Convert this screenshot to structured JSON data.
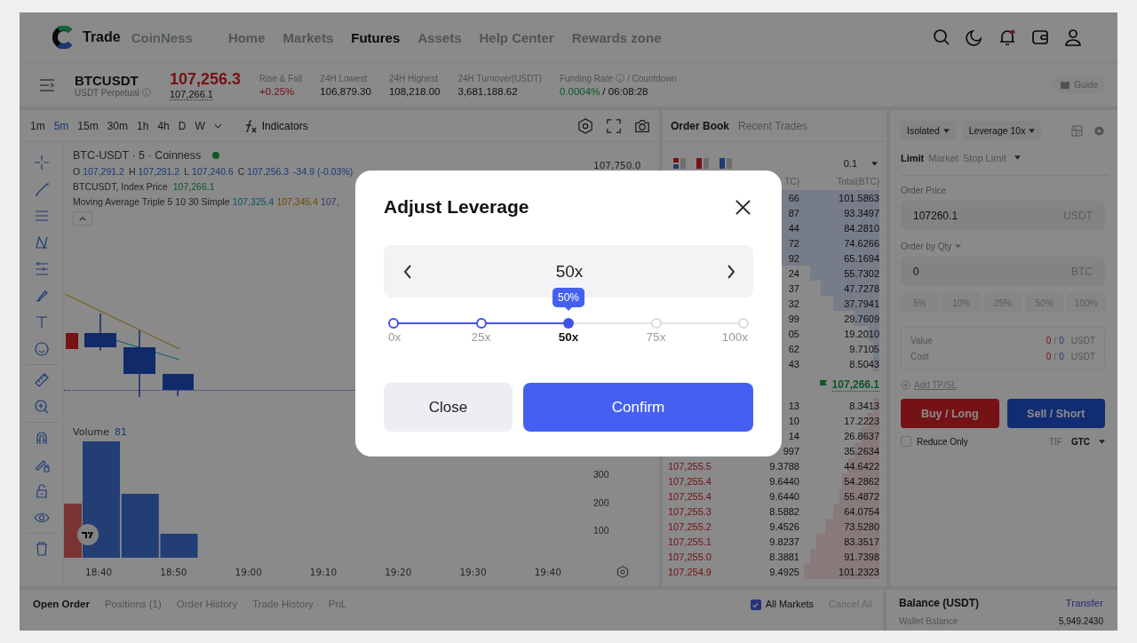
{
  "nav": {
    "logo_text": "Trade",
    "brand": "CoinNess",
    "items": [
      {
        "label": "Home",
        "selected": false
      },
      {
        "label": "Markets",
        "selected": false
      },
      {
        "label": "Futures",
        "selected": true
      },
      {
        "label": "Assets",
        "selected": false
      },
      {
        "label": "Help Center",
        "selected": false
      },
      {
        "label": "Rewards zone",
        "selected": false
      }
    ],
    "has_unread": true
  },
  "ticker": {
    "symbol": "BTCUSDT",
    "contract": "USDT Perpetual",
    "last_price": "107,256.3",
    "mark_price": "107,266.1",
    "stats": [
      {
        "label": "Rise & Fall",
        "value": "+0.25%",
        "highlight": true
      },
      {
        "label": "24H Lowest",
        "value": "106,879.30",
        "highlight": false
      },
      {
        "label": "24H Highest",
        "value": "108,218.00",
        "highlight": false
      },
      {
        "label": "24H Turnover(USDT)",
        "value": "3,681,188.62",
        "highlight": false
      }
    ],
    "funding": {
      "label": "Funding Rate",
      "label_tail": "/ Countdown",
      "rate": "0.0004%",
      "countdown": "/ 06:08:28"
    },
    "guide": "Guide"
  },
  "chart": {
    "intervals": [
      {
        "label": "1m",
        "selected": false
      },
      {
        "label": "5m",
        "selected": true
      },
      {
        "label": "15m",
        "selected": false
      },
      {
        "label": "30m",
        "selected": false
      },
      {
        "label": "1h",
        "selected": false
      },
      {
        "label": "4h",
        "selected": false
      },
      {
        "label": "D",
        "selected": false
      },
      {
        "label": "W",
        "selected": false
      }
    ],
    "indicators": "Indicators",
    "legend": {
      "title": "BTC-USDT · 5 · Coinness",
      "live": true,
      "ohlc": [
        {
          "label": "O",
          "value": "107,291.2"
        },
        {
          "label": "H",
          "value": "107,291.2"
        },
        {
          "label": "L",
          "value": "107,240.6"
        },
        {
          "label": "C",
          "value": "107,256.3"
        }
      ],
      "change": "-34.9 (-0.03%)",
      "index_label": "BTCUSDT, Index Price",
      "index_value": "107,266.1",
      "ma_label": "Moving Average Triple 5 10 30 Simple",
      "ma_values": [
        "107,325.4",
        "107,345.4",
        "107,"
      ]
    },
    "price_tick": "107,750.0",
    "volume": {
      "label": "Volume",
      "value": "81",
      "ticks": [
        "300",
        "200",
        "100"
      ]
    },
    "time_axis": [
      "18:40",
      "18:50",
      "19:00",
      "19:10",
      "19:20",
      "19:30",
      "19:40"
    ]
  },
  "order_book": {
    "tabs": [
      {
        "label": "Order Book",
        "selected": true
      },
      {
        "label": "Recent Trades",
        "selected": false
      }
    ],
    "step": "0.1",
    "columns": [
      "TC)",
      "Total(BTC)"
    ],
    "asks": [
      {
        "quantity": "66",
        "total": "101.5863"
      },
      {
        "quantity": "87",
        "total": "93.3497"
      },
      {
        "quantity": "44",
        "total": "84.2810"
      },
      {
        "quantity": "72",
        "total": "74.6266"
      },
      {
        "quantity": "92",
        "total": "65.1694"
      },
      {
        "quantity": "24",
        "total": "55.7302"
      },
      {
        "quantity": "37",
        "total": "47.7278"
      },
      {
        "quantity": "32",
        "total": "37.7941"
      },
      {
        "quantity": "99",
        "total": "29.7609"
      },
      {
        "quantity": "05",
        "total": "19.2010"
      },
      {
        "quantity": "62",
        "total": "9.7105"
      },
      {
        "quantity": "43",
        "total": "8.5043"
      }
    ],
    "mid_price": "107,266.1",
    "bids": [
      {
        "quantity": "13",
        "total": "8.3413"
      },
      {
        "quantity": "10",
        "total": "17.2223"
      },
      {
        "quantity": "14",
        "total": "26.8637"
      },
      {
        "quantity": "997",
        "total": "35.2634"
      },
      {
        "price": "107,255.5",
        "quantity": "9.3788",
        "total": "44.6422"
      },
      {
        "price": "107,255.4",
        "quantity": "9.6440",
        "total": "54.2862"
      },
      {
        "price": "107,255.4",
        "quantity": "9.6440",
        "total": "55.4872"
      },
      {
        "price": "107,255.3",
        "quantity": "8.5882",
        "total": "64.0754"
      },
      {
        "price": "107,255.2",
        "quantity": "9.4526",
        "total": "73.5280"
      },
      {
        "price": "107,255.1",
        "quantity": "9.8237",
        "total": "83.3517"
      },
      {
        "price": "107,255.0",
        "quantity": "8.3881",
        "total": "91.7398"
      },
      {
        "price": "107,254.9",
        "quantity": "9.4925",
        "total": "101.2323"
      }
    ]
  },
  "order_form": {
    "margin_mode": "Isolated",
    "leverage": "Leverage 10x",
    "order_types": [
      {
        "label": "Limit",
        "selected": true
      },
      {
        "label": "Market",
        "selected": false
      },
      {
        "label": "Stop Limit",
        "selected": false
      }
    ],
    "price_field": {
      "label": "Order Price",
      "value": "107260.1",
      "unit": "USDT"
    },
    "qty_field": {
      "label": "Order by Qty",
      "value": "0",
      "unit": "BTC"
    },
    "percents": [
      "5%",
      "10%",
      "25%",
      "50%",
      "100%"
    ],
    "summary": [
      {
        "label": "Value",
        "long": "0",
        "separator": "/",
        "short": "0",
        "unit": "USDT"
      },
      {
        "label": "Cost",
        "long": "0",
        "separator": "/",
        "short": "0",
        "unit": "USDT"
      }
    ],
    "add_tpsl": "Add TP/SL",
    "buy": "Buy / Long",
    "sell": "Sell / Short",
    "reduce_only": {
      "label": "Reduce Only",
      "checked": false
    },
    "tif_label": "TIF",
    "tif": "GTC"
  },
  "orders": {
    "tabs": [
      {
        "label": "Open Order",
        "selected": true
      },
      {
        "label": "Positions (1)",
        "selected": false
      },
      {
        "label": "Order History",
        "selected": false
      },
      {
        "label": "Trade History",
        "selected": false
      },
      {
        "label": "PnL",
        "selected": false
      }
    ],
    "all_markets": {
      "label": "All Markets",
      "checked": true
    },
    "cancel_all": {
      "label": "Cancel All",
      "disabled": true
    }
  },
  "balance": {
    "title": "Balance (USDT)",
    "transfer": "Transfer",
    "rows": [
      {
        "label": "Wallet Balance",
        "value": "5,949.2430"
      }
    ]
  },
  "modal": {
    "title": "Adjust Leverage",
    "value": "50x",
    "slider": {
      "level": 0.5,
      "tooltip": "50%",
      "marks": [
        {
          "label": "0x",
          "selected": false
        },
        {
          "label": "25x",
          "selected": false
        },
        {
          "label": "50x",
          "selected": true
        },
        {
          "label": "75x",
          "selected": false
        },
        {
          "label": "100x",
          "selected": false
        }
      ]
    },
    "buttons": [
      {
        "label": "Close",
        "kind": "secondary"
      },
      {
        "label": "Confirm",
        "kind": "primary"
      }
    ]
  }
}
